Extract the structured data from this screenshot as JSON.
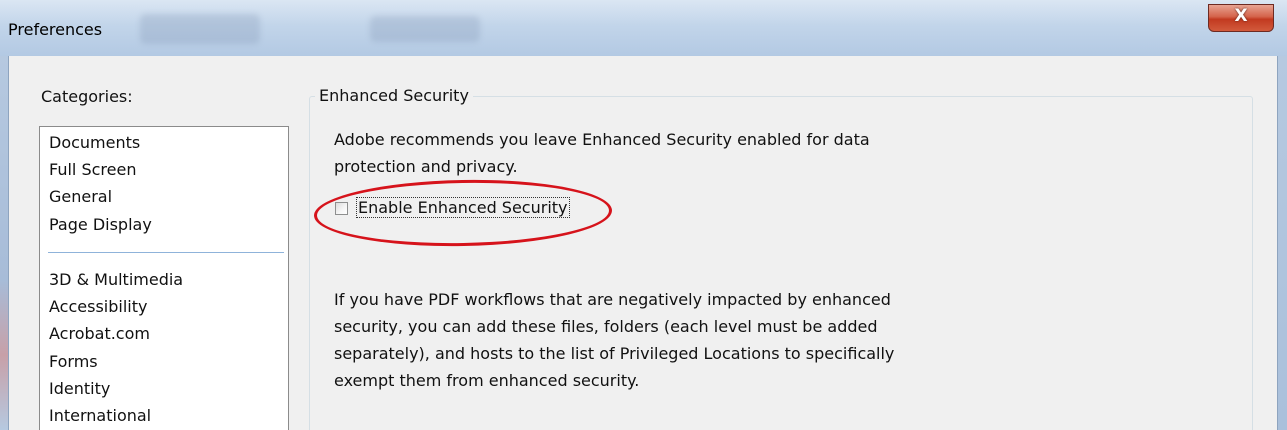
{
  "window": {
    "title": "Preferences",
    "close_label": "X"
  },
  "categories": {
    "label": "Categories:",
    "group1": [
      "Documents",
      "Full Screen",
      "General",
      "Page Display"
    ],
    "group2": [
      "3D & Multimedia",
      "Accessibility",
      "Acrobat.com",
      "Forms",
      "Identity",
      "International"
    ]
  },
  "panel": {
    "group_title": "Enhanced Security",
    "intro_text": "Adobe recommends you leave Enhanced Security enabled for data protection and privacy.",
    "checkbox_label": "Enable Enhanced Security",
    "checkbox_checked": false,
    "privileged_text": "If you have PDF workflows that are negatively impacted by enhanced security, you can add these files, folders (each level must be added separately), and hosts to the list of Privileged Locations to specifically exempt them from enhanced security."
  },
  "colors": {
    "annotation_red": "#d6131b",
    "close_button": "#c23a20"
  }
}
